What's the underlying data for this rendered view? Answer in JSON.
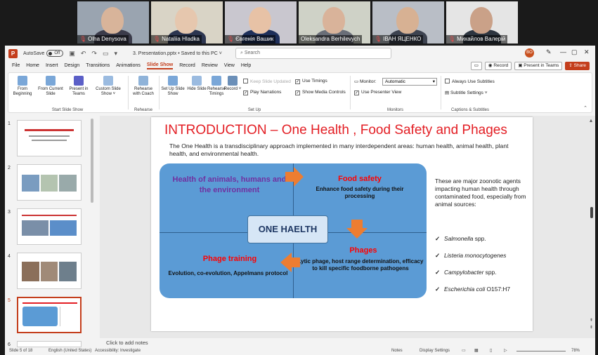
{
  "participants": [
    {
      "name": "Olha Denysova",
      "muted": true,
      "active": false,
      "bg": "#9aa4b0",
      "skin": "#d8b49a",
      "shirt": "#3b3b4a"
    },
    {
      "name": "Nataliia Hladka",
      "muted": true,
      "active": false,
      "bg": "#d9d4c6",
      "skin": "#e6c7ae",
      "shirt": "#2c3550"
    },
    {
      "name": "Євгенія Вашик",
      "muted": true,
      "active": false,
      "bg": "#c9c7cf",
      "skin": "#e7c2a6",
      "shirt": "#1e2f5a"
    },
    {
      "name": "Oleksandra Berhilevych",
      "muted": false,
      "active": true,
      "bg": "#cfd2c7",
      "skin": "#d9b39a",
      "shirt": "#6a6e78"
    },
    {
      "name": "ІВАН ЯЦЕНКО",
      "muted": true,
      "active": false,
      "bg": "#b9bec6",
      "skin": "#d7b193",
      "shirt": "#3d4350"
    },
    {
      "name": "Михайлов Валерій",
      "muted": true,
      "active": false,
      "bg": "#e5e5e5",
      "skin": "#caa188",
      "shirt": "#2d3540"
    }
  ],
  "titlebar": {
    "autosave_label": "AutoSave",
    "autosave_state": "Off",
    "doc_title": "3. Presentation.pptx • Saved to this PC ˅",
    "search_placeholder": "Search",
    "user_initials": "BO"
  },
  "menu": {
    "items": [
      "File",
      "Home",
      "Insert",
      "Design",
      "Transitions",
      "Animations",
      "Slide Show",
      "Record",
      "Review",
      "View",
      "Help"
    ],
    "active": "Slide Show",
    "record_label": "Record",
    "present_label": "Present in Teams",
    "share_label": "Share"
  },
  "ribbon": {
    "start_group": "Start Slide Show",
    "from_beginning": "From Beginning",
    "from_current": "From Current Slide",
    "present_teams": "Present in Teams",
    "custom_show": "Custom Slide Show ˅",
    "rehearse_group": "Rehearse",
    "rehearse_coach": "Rehearse with Coach",
    "setup_group": "Set Up",
    "setup_show": "Set Up Slide Show",
    "hide_slide": "Hide Slide",
    "rehearse_timings": "Rehearse Timings",
    "record": "Record ˅",
    "keep_updated": "Keep Slide Updated",
    "play_narrations": "Play Narrations",
    "use_timings": "Use Timings",
    "show_media": "Show Media Controls",
    "monitors_group": "Monitors",
    "monitor_label": "Monitor:",
    "monitor_value": "Automatic",
    "presenter_view": "Use Presenter View",
    "captions_group": "Captions & Subtitles",
    "always_subtitles": "Always Use Subtitles",
    "subtitle_settings": "Subtitle Settings ˅"
  },
  "thumbnails": [
    {
      "num": "1",
      "current": false
    },
    {
      "num": "2",
      "current": false
    },
    {
      "num": "3",
      "current": false
    },
    {
      "num": "4",
      "current": false
    },
    {
      "num": "5",
      "current": true
    },
    {
      "num": "6",
      "current": false
    }
  ],
  "slide": {
    "title": "INTRODUCTION – One Health , Food Safety and Phages",
    "intro": "The One Health is a transdisciplinary approach implemented in many interdependent areas: human health, animal health, plant health, and environmental health.",
    "center": "ONE HAELTH",
    "q1_title": "Health of animals, humans and the environment",
    "q2_title": "Food safety",
    "q2_body": "Enhance food safety during their processing",
    "q3_title": "Phage training",
    "q3_body": "Evolution, co-evolution, Appelmans protocol",
    "q4_title": "Phages",
    "q4_body": "Lytic phage, host range determination, efficacy to kill specific foodborne pathogens",
    "side_text": "These are major zoonotic agents impacting human health through contaminated food, especially from animal sources:",
    "bullets": [
      {
        "italic": "Salmonella",
        "rest": " spp."
      },
      {
        "italic": "Listeria monocytogenes",
        "rest": ""
      },
      {
        "italic": "Campylobacter",
        "rest": " spp."
      },
      {
        "italic": "Escherichia coli",
        "rest": " O157:H7"
      }
    ],
    "colors": {
      "title": "#e31e24",
      "purple": "#7030a0",
      "red": "#ff0000",
      "arrow": "#ed7d31",
      "box": "#5b9bd5"
    }
  },
  "notes_placeholder": "Click to add notes",
  "status": {
    "slide_of": "Slide 5 of 18",
    "language": "English (United States)",
    "accessibility": "Accessibility: Investigate",
    "notes": "Notes",
    "display": "Display Settings",
    "zoom": "78%"
  }
}
